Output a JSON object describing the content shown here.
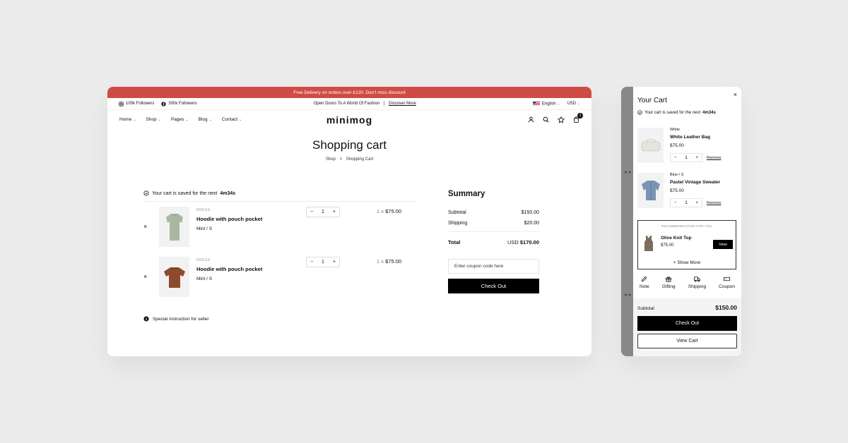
{
  "promo_bar": {
    "text": "Free Delivery on orders over £120. Don’t miss discount"
  },
  "topbar": {
    "instagram_followers": "100k Followers",
    "facebook_followers": "300k Followers",
    "message": "Open Doors To A World Of Fashion",
    "message_separator": "|",
    "discover_link": "Discover More",
    "language": "English",
    "currency": "USD"
  },
  "nav": {
    "logo": "minimog",
    "menu": [
      "Home",
      "Shop",
      "Pages",
      "Blog",
      "Contact"
    ],
    "cart_count": "1"
  },
  "page": {
    "title": "Shopping cart",
    "breadcrumb_parent": "Shop",
    "breadcrumb_separator": ">",
    "breadcrumb_current": "Shopping Cart"
  },
  "cart": {
    "saved_text": "Your cart is saved for the next",
    "saved_time": "4m34s",
    "items": [
      {
        "category": "DRESS",
        "name": "Hoodie with pouch pocket",
        "variant": "Mint / S",
        "qty": "1",
        "price_mul": "1 x",
        "price": "$75.00",
        "color": "#a9b7a2"
      },
      {
        "category": "DRESS",
        "name": "Hoodie with pouch pocket",
        "variant": "Mint / S",
        "qty": "1",
        "price_mul": "1 x",
        "price": "$75.00",
        "color": "#8e4a2e"
      }
    ],
    "instruction": "Special instruction for seller"
  },
  "summary": {
    "title": "Summary",
    "subtotal_label": "Subtotal",
    "subtotal": "$150.00",
    "shipping_label": "Shipping",
    "shipping": "$20.00",
    "total_label": "Total",
    "total_currency": "USD",
    "total": "$170.00",
    "coupon_placeholder": "Enter coupon code here",
    "checkout": "Check Out"
  },
  "drawer": {
    "title": "Your Cart",
    "saved_text": "Your cart is saved for the next",
    "saved_time": "4m34s",
    "items": [
      {
        "variant": "White",
        "name": "White Leather Bag",
        "price": "$75.00",
        "qty": "1",
        "remove": "Remove",
        "color": "#e6e4dc"
      },
      {
        "variant": "Blue / S",
        "name": "Pastel Vintage Sweater",
        "price": "$75.00",
        "qty": "1",
        "remove": "Remove",
        "color": "#7b93b4"
      }
    ],
    "recommendation": {
      "title": "RECOMMENDATION FOR YOU",
      "name": "Olive Knit Top",
      "price": "$75.00",
      "view": "View",
      "show_more": "+ Show More",
      "color": "#7d6e5c"
    },
    "tools": [
      "Note",
      "Gifting",
      "Shipping",
      "Coupon"
    ],
    "subtotal_label": "Subtotal",
    "subtotal": "$150.00",
    "checkout": "Check Out",
    "view_cart": "View Cart"
  },
  "colors": {
    "promo": "#d04b45",
    "background": "#ececec",
    "button": "#000000"
  }
}
